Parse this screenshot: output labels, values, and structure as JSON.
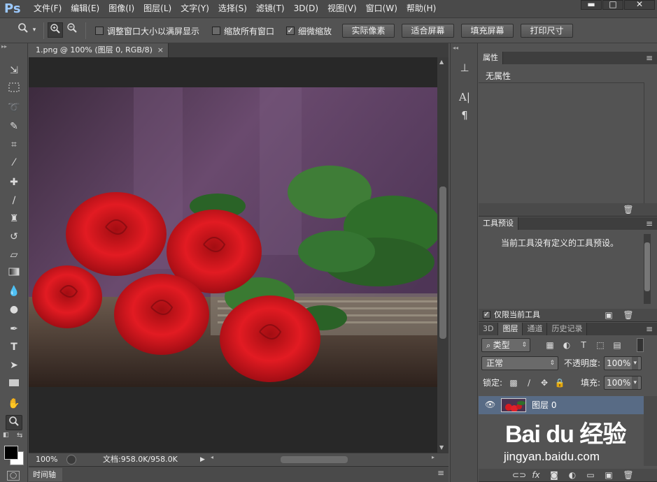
{
  "app": {
    "logo": "Ps"
  },
  "menu": [
    "文件(F)",
    "编辑(E)",
    "图像(I)",
    "图层(L)",
    "文字(Y)",
    "选择(S)",
    "滤镜(T)",
    "3D(D)",
    "视图(V)",
    "窗口(W)",
    "帮助(H)"
  ],
  "window_controls": {
    "minimize": "▬",
    "maximize": "□",
    "close": "✕"
  },
  "options": {
    "resize_windows": {
      "label": "调整窗口大小以满屏显示",
      "checked": false
    },
    "zoom_all": {
      "label": "缩放所有窗口",
      "checked": false
    },
    "scrubby_zoom": {
      "label": "细微缩放",
      "checked": true
    },
    "buttons": [
      "实际像素",
      "适合屏幕",
      "填充屏幕",
      "打印尺寸"
    ]
  },
  "document": {
    "tab_title": "1.png @ 100% (图层 0, RGB/8)",
    "tab_close": "×",
    "zoom": "100%",
    "info": "文档:958.0K/958.0K"
  },
  "timeline": {
    "label": "时间轴"
  },
  "properties": {
    "title": "属性",
    "empty_text": "无属性"
  },
  "tool_presets": {
    "title": "工具预设",
    "message": "当前工具没有定义的工具预设。",
    "current_only": {
      "label": "仅限当前工具",
      "checked": true
    }
  },
  "layers_panel": {
    "tabs": [
      "3D",
      "图层",
      "通道",
      "历史记录"
    ],
    "active_tab": "图层",
    "filter_label": "类型",
    "blend_mode": "正常",
    "opacity_label": "不透明度:",
    "opacity_value": "100%",
    "lock_label": "锁定:",
    "fill_label": "填充:",
    "fill_value": "100%",
    "layers": [
      {
        "name": "图层 0",
        "visible": true,
        "selected": true
      }
    ]
  },
  "watermark": {
    "brand": "Bai du 经验",
    "site": "jingyan.baidu.com"
  },
  "icons": {
    "tools": [
      "move-icon",
      "marquee-icon",
      "lasso-icon",
      "quick-select-icon",
      "crop-icon",
      "eyedropper-icon",
      "healing-brush-icon",
      "brush-icon",
      "clone-stamp-icon",
      "history-brush-icon",
      "eraser-icon",
      "gradient-icon",
      "blur-icon",
      "dodge-icon",
      "pen-icon",
      "type-icon",
      "path-select-icon",
      "rectangle-icon",
      "hand-icon",
      "zoom-icon"
    ]
  }
}
